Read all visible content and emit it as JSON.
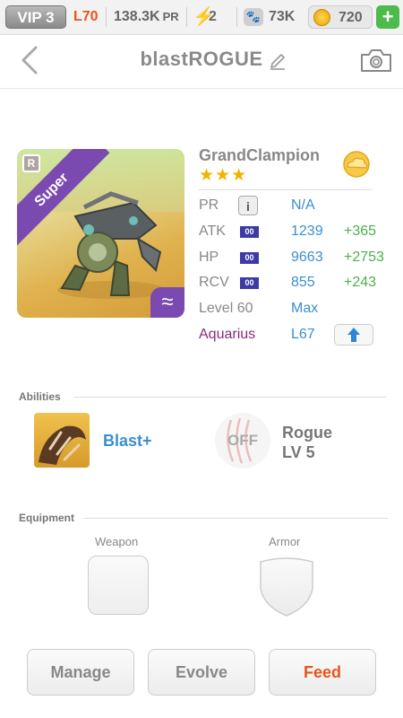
{
  "status_bar": {
    "vip": "VIP 3",
    "level": "L70",
    "power": "138.3K",
    "power_unit": "PR",
    "energy": "2",
    "paw_count": "73K",
    "coins": "720",
    "add_icon": "plus-icon"
  },
  "header": {
    "title": "blastROGUE",
    "back_icon": "chevron-left-icon",
    "edit_icon": "pencil-icon",
    "camera_icon": "camera-icon"
  },
  "monster": {
    "card_label": "Super",
    "rarity_badge": "R",
    "element_symbol": "≈",
    "name": "GrandClampion",
    "stars": "★★★",
    "stats": {
      "pr": {
        "label": "PR",
        "info_icon": "i",
        "value": "N/A"
      },
      "atk": {
        "label": "ATK",
        "badge": "00",
        "value": "1239",
        "bonus": "+365"
      },
      "hp": {
        "label": "HP",
        "badge": "00",
        "value": "9663",
        "bonus": "+2753"
      },
      "rcv": {
        "label": "RCV",
        "badge": "00",
        "value": "855",
        "bonus": "+243"
      },
      "level": {
        "label": "Level 60",
        "value": "Max"
      },
      "constellation": {
        "label": "Aquarius",
        "value": "L67",
        "icon": "arrow-up-icon"
      }
    }
  },
  "abilities": {
    "title": "Abilities",
    "primary": {
      "name": "Blast+"
    },
    "secondary": {
      "status": "OFF",
      "name": "Rogue",
      "level": "LV 5"
    }
  },
  "equipment": {
    "title": "Equipment",
    "weapon_label": "Weapon",
    "armor_label": "Armor"
  },
  "actions": {
    "manage": "Manage",
    "evolve": "Evolve",
    "feed": "Feed"
  },
  "colors": {
    "accent_orange": "#e8541a",
    "value_blue": "#3a8fd0",
    "bonus_green": "#4cb04c",
    "rarity_purple": "#7a4ab0"
  }
}
